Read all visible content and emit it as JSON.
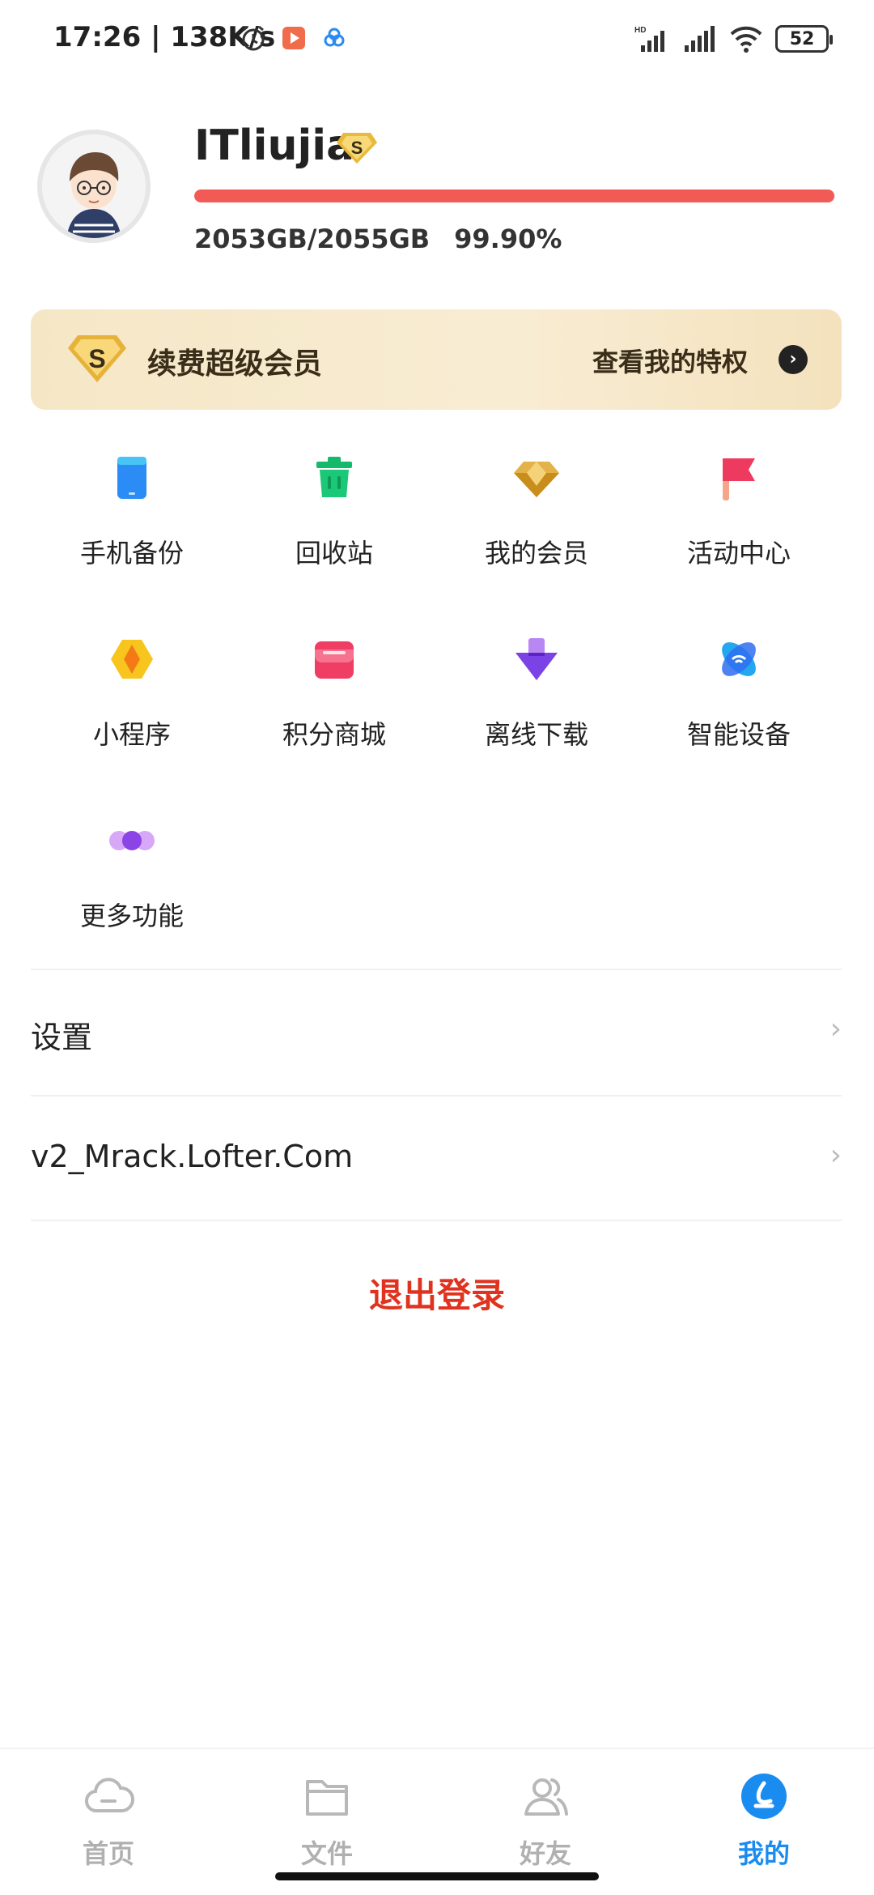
{
  "status_bar": {
    "time": "17:26 | 138K/s",
    "battery": "52",
    "network": "HD"
  },
  "profile": {
    "username": "ITliujia",
    "vip_badge": "S",
    "quota_used": "2053GB/2055GB",
    "quota_percent": "99.90%",
    "quota_fraction": 0.999,
    "quota_color": "#f25b55"
  },
  "vip_banner": {
    "badge": "S",
    "title": "续费超级会员",
    "link": "查看我的特权",
    "arrow": "›"
  },
  "grid": {
    "items": [
      {
        "label": "手机备份",
        "icon": "phone-backup-icon"
      },
      {
        "label": "回收站",
        "icon": "trash-icon"
      },
      {
        "label": "我的会员",
        "icon": "diamond-icon"
      },
      {
        "label": "活动中心",
        "icon": "flag-icon"
      },
      {
        "label": "小程序",
        "icon": "mini-program-icon"
      },
      {
        "label": "积分商城",
        "icon": "store-icon"
      },
      {
        "label": "离线下载",
        "icon": "offline-download-icon"
      },
      {
        "label": "智能设备",
        "icon": "smart-device-icon"
      },
      {
        "label": "更多功能",
        "icon": "more-functions-icon"
      }
    ]
  },
  "list": {
    "settings": "设置",
    "account": "v2_Mrack.Lofter.Com",
    "chevron": "›"
  },
  "logout": "退出登录",
  "bottom_nav": {
    "items": [
      {
        "label": "首页",
        "icon": "cloud-icon",
        "active": false
      },
      {
        "label": "文件",
        "icon": "folder-icon",
        "active": false
      },
      {
        "label": "好友",
        "icon": "friends-icon",
        "active": false
      },
      {
        "label": "我的",
        "icon": "me-icon",
        "active": true
      }
    ],
    "active_color": "#1a8cf0"
  }
}
